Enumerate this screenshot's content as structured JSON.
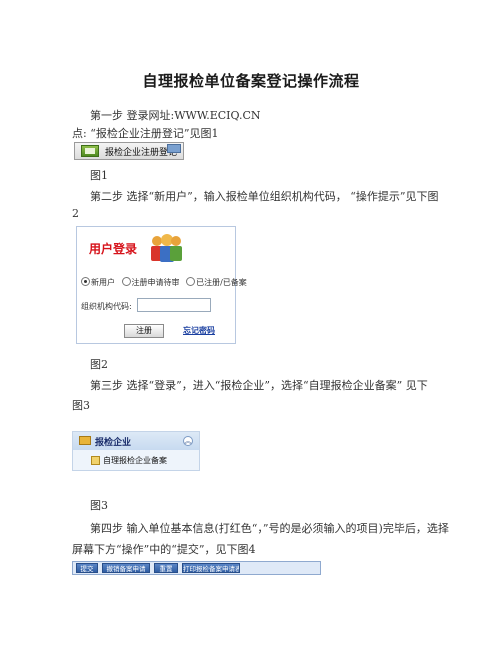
{
  "document": {
    "title": "自理报检单位备案登记操作流程",
    "step1": "第一步  登录网址:WWW.ECIQ.CN",
    "step1_cont": "点: “报检企业注册登记”见图1",
    "fig1_caption": "图1",
    "step2": "第二步  选择“新用户”，输入报检单位组织机构代码，  “操作提示”见下图",
    "step2_cont": "2",
    "fig2_caption": "图2",
    "step3": "第三步  选择“登录”，进入“报检企业”，选择“自理报检企业备案”  见下",
    "step3_cont": "图3",
    "fig3_caption": "图3",
    "step4": "第四步  输入单位基本信息(打红色“，”号的是必须输入的项目)完毕后，选择",
    "step4_cont": "屏幕下方“操作”中的“提交”，见下图4"
  },
  "fig1": {
    "button_label": "报检企业注册登记",
    "icon": "register-icon"
  },
  "fig2": {
    "header": "用户登录",
    "users_icon": "users-icon",
    "radio_options": [
      "新用户",
      "注册申请待审",
      "已注册/已备案"
    ],
    "selected_option": "新用户",
    "org_code_label": "组织机构代码:",
    "org_code_value": "",
    "register_button": "注册",
    "forgot_password": "忘记密码"
  },
  "fig3": {
    "group_label": "报检企业",
    "item_label": "自理报检企业备案",
    "collapse_icon": "chevron-up-icon"
  },
  "fig4": {
    "buttons": [
      "提交",
      "撤销备案申请",
      "重置",
      "打印报检备案申请表"
    ]
  },
  "colors": {
    "header_red": "#d6121a",
    "link_blue": "#1a3fa0",
    "toolbar_blue": "#2f5da3"
  }
}
